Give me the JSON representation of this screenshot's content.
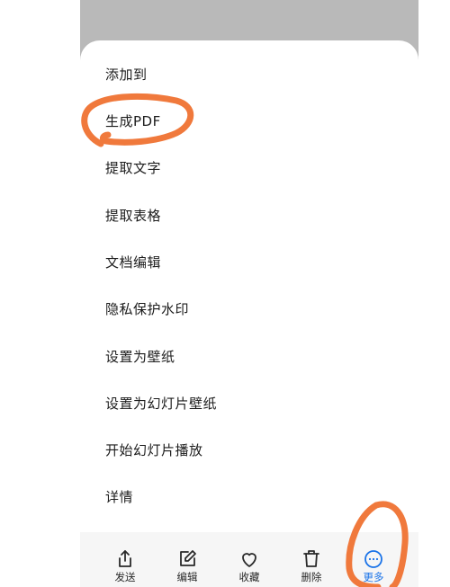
{
  "menu": {
    "items": [
      {
        "label": "添加到"
      },
      {
        "label": "生成PDF"
      },
      {
        "label": "提取文字"
      },
      {
        "label": "提取表格"
      },
      {
        "label": "文档编辑"
      },
      {
        "label": "隐私保护水印"
      },
      {
        "label": "设置为壁纸"
      },
      {
        "label": "设置为幻灯片壁纸"
      },
      {
        "label": "开始幻灯片播放"
      },
      {
        "label": "详情"
      }
    ]
  },
  "toolbar": {
    "send_label": "发送",
    "edit_label": "编辑",
    "favorite_label": "收藏",
    "delete_label": "删除",
    "more_label": "更多"
  },
  "colors": {
    "accent": "#1a73e8",
    "annotation": "#f0793c",
    "overlay": "#b9b9b9"
  },
  "icons": [
    "share-icon",
    "edit-icon",
    "heart-icon",
    "trash-icon",
    "more-dots-icon"
  ]
}
